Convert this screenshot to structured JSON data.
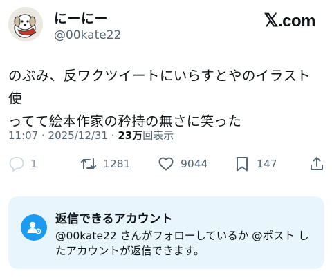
{
  "header": {
    "display_name": "にーにー",
    "handle": "@00kate22",
    "brand_x": "𝕏",
    "brand_suffix": ".com"
  },
  "post": {
    "text_line1": "のぶみ、反ワクツイートにいらすとやのイラスト使",
    "text_line2": "ってて絵本作家の矜持の無さに笑った"
  },
  "meta": {
    "time": "11:07",
    "separator": " · ",
    "date": "2025/12/31",
    "views_count": "23万",
    "views_label": "回表示"
  },
  "actions": {
    "reply_count": "1",
    "retweet_count": "1281",
    "like_count": "9044",
    "bookmark_count": "147"
  },
  "reply_settings": {
    "title": "返信できるアカウント",
    "body": "@00kate22 さんがフォローしているか @ポスト したアカウントが返信できます。"
  },
  "icons": {
    "reply": "reply-icon",
    "retweet": "retweet-icon",
    "like": "heart-icon",
    "bookmark": "bookmark-icon",
    "share": "share-icon",
    "mention": "person-mention-icon"
  },
  "colors": {
    "accent": "#1d9bf0",
    "muted": "#536471",
    "card_bg": "#e8f5fd"
  }
}
